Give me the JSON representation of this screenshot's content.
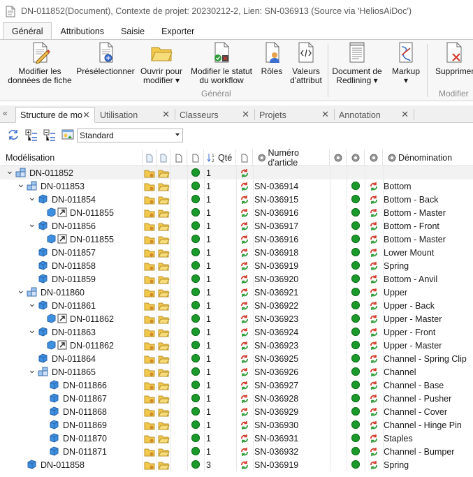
{
  "window": {
    "title": "DN-011852(Document), Contexte de projet: 20230212-2, Lien: SN-036913  (Source via 'HeliosAiDoc')"
  },
  "ribbon": {
    "tabs": [
      "Général",
      "Attributions",
      "Saisie",
      "Exporter"
    ],
    "active_tab": 0,
    "buttons": [
      {
        "label1": "Modifier les",
        "label2": "données de fiche",
        "icon": "edit-data-icon"
      },
      {
        "label1": "Présélectionner",
        "label2": "",
        "icon": "preselect-icon"
      },
      {
        "label1": "Ouvrir pour",
        "label2": "modifier ▾",
        "icon": "open-folder-icon"
      },
      {
        "label1": "Modifier le statut",
        "label2": "du workflow",
        "icon": "workflow-status-icon"
      },
      {
        "label1": "Rôles",
        "label2": "",
        "icon": "roles-icon"
      },
      {
        "label1": "Valeurs",
        "label2": "d'attribut",
        "icon": "attribute-values-icon"
      },
      {
        "label1": "Document de",
        "label2": "Redlining ▾",
        "icon": "redlining-document-icon"
      },
      {
        "label1": "Markup",
        "label2": "▾",
        "icon": "markup-icon"
      },
      {
        "label1": "Supprimer",
        "label2": "",
        "icon": "delete-icon"
      }
    ],
    "groups": [
      "Général",
      "Modifier"
    ]
  },
  "doc_tabs": {
    "collapse_glyph": "«",
    "tabs": [
      "Structure de mo",
      "Utilisation",
      "Classeurs",
      "Projets",
      "Annotation"
    ],
    "active": 0,
    "close_glyph": "✕"
  },
  "toolbar": {
    "view_select": "Standard"
  },
  "grid": {
    "headers": {
      "modelisation": "Modélisation",
      "qty": "Qté",
      "article_number": "Numéro d'article",
      "designation": "Dénomination"
    },
    "rows": [
      {
        "level": 0,
        "expand": "v",
        "type": "assembly",
        "id": "DN-011852",
        "qty": "1",
        "article": "",
        "designation": "",
        "selected": true,
        "folders": true,
        "dot": true,
        "link": false
      },
      {
        "level": 1,
        "expand": "v",
        "type": "assembly",
        "id": "DN-011853",
        "qty": "1",
        "article": "SN-036914",
        "designation": "Bottom",
        "folders": true,
        "dot": true
      },
      {
        "level": 2,
        "expand": "v",
        "type": "part",
        "id": "DN-011854",
        "qty": "1",
        "article": "SN-036915",
        "designation": "Bottom - Back",
        "folders": true,
        "dot": true
      },
      {
        "level": 3,
        "expand": "",
        "type": "drawing",
        "id": "DN-011855",
        "qty": "1",
        "article": "SN-036916",
        "designation": "Bottom - Master",
        "folders": true,
        "dot": true
      },
      {
        "level": 2,
        "expand": "v",
        "type": "part",
        "id": "DN-011856",
        "qty": "1",
        "article": "SN-036917",
        "designation": "Bottom - Front",
        "folders": true,
        "dot": true
      },
      {
        "level": 3,
        "expand": "",
        "type": "drawing",
        "id": "DN-011855",
        "qty": "1",
        "article": "SN-036916",
        "designation": "Bottom - Master",
        "folders": true,
        "dot": true
      },
      {
        "level": 2,
        "expand": "",
        "type": "part",
        "id": "DN-011857",
        "qty": "1",
        "article": "SN-036918",
        "designation": "Lower Mount",
        "folders": true,
        "dot": true
      },
      {
        "level": 2,
        "expand": "",
        "type": "part",
        "id": "DN-011858",
        "qty": "1",
        "article": "SN-036919",
        "designation": "Spring",
        "folders": true,
        "dot": true
      },
      {
        "level": 2,
        "expand": "",
        "type": "part",
        "id": "DN-011859",
        "qty": "1",
        "article": "SN-036920",
        "designation": "Bottom - Anvil",
        "folders": true,
        "dot": true
      },
      {
        "level": 1,
        "expand": "v",
        "type": "assembly",
        "id": "DN-011860",
        "qty": "1",
        "article": "SN-036921",
        "designation": "Upper",
        "folders": true,
        "dot": true
      },
      {
        "level": 2,
        "expand": "v",
        "type": "part",
        "id": "DN-011861",
        "qty": "1",
        "article": "SN-036922",
        "designation": "Upper - Back",
        "folders": true,
        "dot": true
      },
      {
        "level": 3,
        "expand": "",
        "type": "drawing",
        "id": "DN-011862",
        "qty": "1",
        "article": "SN-036923",
        "designation": "Upper - Master",
        "folders": true,
        "dot": true
      },
      {
        "level": 2,
        "expand": "v",
        "type": "part",
        "id": "DN-011863",
        "qty": "1",
        "article": "SN-036924",
        "designation": "Upper - Front",
        "folders": true,
        "dot": true
      },
      {
        "level": 3,
        "expand": "",
        "type": "drawing",
        "id": "DN-011862",
        "qty": "1",
        "article": "SN-036923",
        "designation": "Upper - Master",
        "folders": true,
        "dot": true
      },
      {
        "level": 2,
        "expand": "",
        "type": "part",
        "id": "DN-011864",
        "qty": "1",
        "article": "SN-036925",
        "designation": "Channel - Spring Clip",
        "folders": true,
        "dot": true
      },
      {
        "level": 2,
        "expand": "v",
        "type": "assembly",
        "id": "DN-011865",
        "qty": "1",
        "article": "SN-036926",
        "designation": "Channel",
        "folders": true,
        "dot": true
      },
      {
        "level": 3,
        "expand": "",
        "type": "part",
        "id": "DN-011866",
        "qty": "1",
        "article": "SN-036927",
        "designation": "Channel - Base",
        "folders": true,
        "dot": true
      },
      {
        "level": 3,
        "expand": "",
        "type": "part",
        "id": "DN-011867",
        "qty": "1",
        "article": "SN-036928",
        "designation": "Channel - Pusher",
        "folders": true,
        "dot": true
      },
      {
        "level": 3,
        "expand": "",
        "type": "part",
        "id": "DN-011868",
        "qty": "1",
        "article": "SN-036929",
        "designation": "Channel - Cover",
        "folders": true,
        "dot": true
      },
      {
        "level": 3,
        "expand": "",
        "type": "part",
        "id": "DN-011869",
        "qty": "1",
        "article": "SN-036930",
        "designation": "Channel - Hinge Pin",
        "folders": true,
        "dot": true
      },
      {
        "level": 3,
        "expand": "",
        "type": "part",
        "id": "DN-011870",
        "qty": "1",
        "article": "SN-036931",
        "designation": "Staples",
        "folders": true,
        "dot": true
      },
      {
        "level": 3,
        "expand": "",
        "type": "part",
        "id": "DN-011871",
        "qty": "1",
        "article": "SN-036932",
        "designation": "Channel - Bumper",
        "folders": true,
        "dot": true
      },
      {
        "level": 1,
        "expand": "",
        "type": "part",
        "id": "DN-011858",
        "qty": "3",
        "article": "SN-036919",
        "designation": "Spring",
        "folders": true,
        "dot": true
      }
    ]
  },
  "colors": {
    "status_green": "#1a9a2a",
    "folder_yellow": "#f2c94c",
    "part_blue": "#3d8fe0",
    "sync_red": "#d23c2c",
    "sync_green": "#2e9b3a"
  }
}
